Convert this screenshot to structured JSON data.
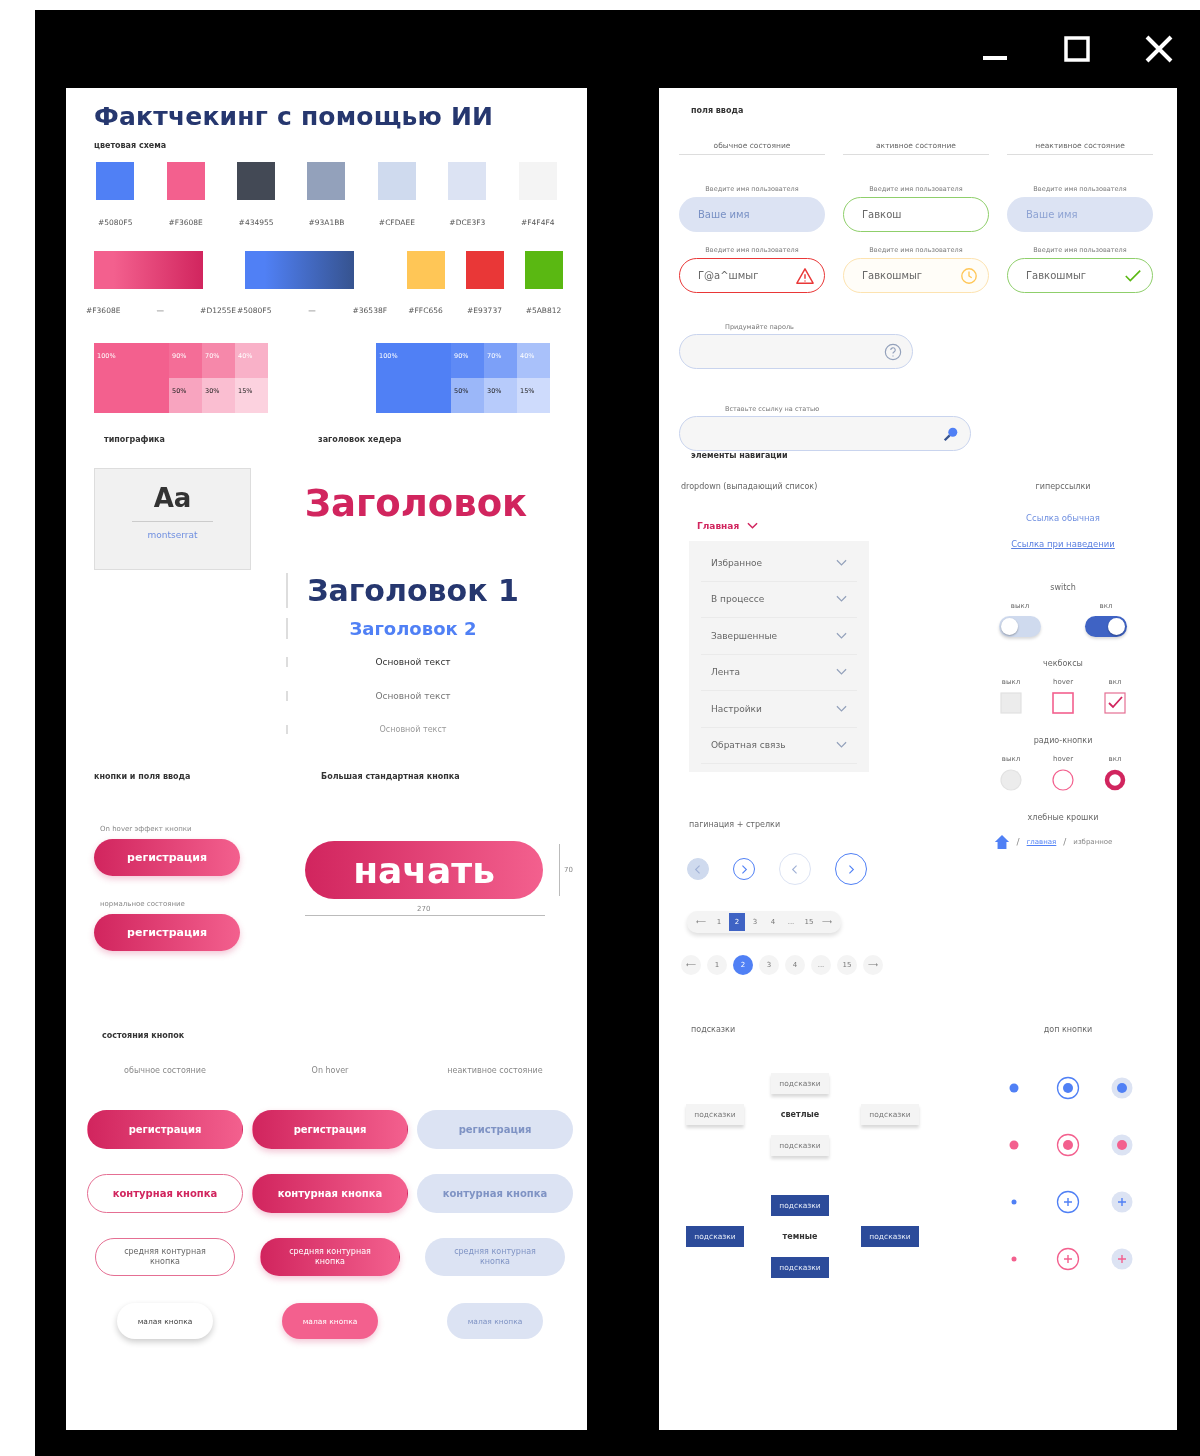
{
  "window_controls": [
    {
      "kind": "minimize"
    },
    {
      "kind": "maximize"
    },
    {
      "kind": "close"
    }
  ],
  "left": {
    "title": "Фактчекинг с помощью ИИ",
    "palette": {
      "heading": "цветовая схема",
      "swatches": [
        {
          "label": "#5080F5",
          "color": "#5080f5"
        },
        {
          "label": "#F3608E",
          "color": "#f3608e"
        },
        {
          "label": "#434955",
          "color": "#434955"
        },
        {
          "label": "#93A1BB",
          "color": "#93a1bb"
        },
        {
          "label": "#CFDAEE",
          "color": "#cfdaee"
        },
        {
          "label": "#DCE3F3",
          "color": "#dce3f3"
        },
        {
          "label": "#F4F4F4",
          "color": "#f4f4f4"
        }
      ],
      "gradients": [
        {
          "from_label": "#F3608E",
          "dash": "—",
          "to_label": "#D1255E",
          "color": "#f3608e"
        },
        {
          "from_label": "#5080F5",
          "dash": "—",
          "to_label": "#36538F",
          "color": "#5080f5"
        }
      ],
      "solids": [
        {
          "label": "#FFC656",
          "color": "#ffc656"
        },
        {
          "label": "#E93737",
          "color": "#e93737"
        },
        {
          "label": "#5AB812",
          "color": "#5ab812"
        }
      ],
      "tints": [
        {
          "color": "#f3608e",
          "cells": [
            {
              "label": "100%"
            },
            {
              "label": "90%"
            },
            {
              "label": "70%"
            },
            {
              "label": "40%"
            },
            {
              "label": "50%"
            },
            {
              "label": "30%"
            },
            {
              "label": "15%"
            }
          ]
        },
        {
          "color": "#5080f5",
          "cells": [
            {
              "label": "100%"
            },
            {
              "label": "90%"
            },
            {
              "label": "70%"
            },
            {
              "label": "40%"
            },
            {
              "label": "50%"
            },
            {
              "label": "30%"
            },
            {
              "label": "15%"
            }
          ]
        }
      ]
    },
    "typography": {
      "heading": "типографика",
      "sample": "Aa",
      "font_name": "montserrat"
    },
    "headers": {
      "heading": "заголовок хедера",
      "items": [
        {
          "label": "Заголовок",
          "kind": "display"
        },
        {
          "label": "Заголовок 1",
          "kind": "h1"
        },
        {
          "label": "Заголовок 2",
          "kind": "h2"
        },
        {
          "label": "Основной текст",
          "kind": "body"
        },
        {
          "label": "Основной текст",
          "kind": "muted"
        },
        {
          "label": "Основной текст",
          "kind": "faint"
        }
      ]
    },
    "buttons": {
      "heading": "кнопки и поля ввода",
      "examples": [
        {
          "caption": "On hover эффект кнопки",
          "label": "регистрация"
        },
        {
          "caption": "нормальное состояние",
          "label": "регистрация"
        }
      ],
      "big": {
        "heading": "Большая стандартная кнопка",
        "label": "начать",
        "width_label": "270",
        "height_label": "70"
      }
    },
    "states": {
      "heading": "состояния кнопок",
      "columns": [
        "обычное состояние",
        "On hover",
        "неактивное состояние"
      ],
      "rows": [
        {
          "kind": "filled",
          "cells": [
            {
              "label": "регистрация",
              "kind": "normal"
            },
            {
              "label": "регистрация",
              "kind": "hover"
            },
            {
              "label": "регистрация",
              "kind": "disabled"
            }
          ]
        },
        {
          "kind": "outline",
          "cells": [
            {
              "label": "контурная кнопка",
              "kind": "normal"
            },
            {
              "label": "контурная кнопка",
              "kind": "hover"
            },
            {
              "label": "контурная кнопка",
              "kind": "disabled"
            }
          ]
        },
        {
          "kind": "medium",
          "cells": [
            {
              "label": "средняя контурная кнопка",
              "kind": "normal"
            },
            {
              "label": "средняя контурная кнопка",
              "kind": "hover"
            },
            {
              "label": "средняя контурная кнопка",
              "kind": "disabled"
            }
          ]
        },
        {
          "kind": "small",
          "cells": [
            {
              "label": "малая кнопка",
              "kind": "normal"
            },
            {
              "label": "малая кнопка",
              "kind": "hover"
            },
            {
              "label": "малая кнопка",
              "kind": "disabled"
            }
          ]
        }
      ]
    }
  },
  "right": {
    "inputs": {
      "heading": "поля ввода",
      "columns": [
        "обычное состояние",
        "активное состояние",
        "неактивное состояние"
      ],
      "fields": [
        {
          "label": "Введите имя пользователя",
          "placeholder": "Ваше имя",
          "kind": "normal"
        },
        {
          "label": "Введите имя пользователя",
          "value": "Гавкош",
          "kind": "active"
        },
        {
          "label": "Введите имя пользователя",
          "placeholder": "Ваше имя",
          "kind": "disabled"
        },
        {
          "label": "Введите имя пользователя",
          "value": "Г@а^шмыг",
          "kind": "error"
        },
        {
          "label": "Введите имя пользователя",
          "value": "Гавкошмыг",
          "kind": "warning"
        },
        {
          "label": "Введите имя пользователя",
          "value": "Гавкошмыг",
          "kind": "success"
        }
      ],
      "extra": [
        {
          "label": "Придумайте пароль",
          "kind": "password"
        },
        {
          "label": "Вставьте ссылку на статью",
          "kind": "search"
        }
      ]
    },
    "navigation": {
      "heading": "элементы навигации",
      "dropdown": {
        "caption": "dropdown (выпадающий список)",
        "label": "Главная",
        "expanded": true,
        "items": [
          "Избранное",
          "В процессе",
          "Завершенные",
          "Лента",
          "Настройки",
          "Обратная связь"
        ]
      },
      "links": {
        "heading": "гиперссылки",
        "items": [
          {
            "label": "Ссылка обычная",
            "hovered": false
          },
          {
            "label": "Ссылка при наведении",
            "hovered": true
          }
        ]
      },
      "switches": {
        "heading": "switch",
        "items": [
          {
            "label": "выкл",
            "on": false
          },
          {
            "label": "вкл",
            "on": true
          }
        ]
      },
      "checkboxes": {
        "heading": "чекбоксы",
        "items": [
          {
            "label": "выкл",
            "checked": false,
            "hovered": false
          },
          {
            "label": "hover",
            "checked": false,
            "hovered": true
          },
          {
            "label": "вкл",
            "checked": true,
            "hovered": false
          }
        ]
      },
      "radios": {
        "heading": "радио-кнопки",
        "items": [
          {
            "label": "выкл",
            "checked": false,
            "hovered": false
          },
          {
            "label": "hover",
            "checked": false,
            "hovered": true
          },
          {
            "label": "вкл",
            "checked": true,
            "hovered": false
          }
        ]
      },
      "breadcrumbs": {
        "heading": "хлебные крошки",
        "items": [
          {
            "kind": "home"
          },
          {
            "kind": "separator",
            "label": "/"
          },
          {
            "kind": "link",
            "label": "главная"
          },
          {
            "kind": "separator",
            "label": "/"
          },
          {
            "kind": "current",
            "label": "избранное"
          }
        ]
      },
      "pagination": {
        "caption": "пагинация + стрелки",
        "arrows": [
          {
            "kind": "prev-small",
            "disabled": true
          },
          {
            "kind": "next-small",
            "disabled": false
          },
          {
            "kind": "prev-large",
            "disabled": true
          },
          {
            "kind": "next-large",
            "disabled": false
          }
        ],
        "pagers": [
          {
            "kind": "bar",
            "items": [
              {
                "label": "⟵",
                "selected": false
              },
              {
                "label": "1",
                "selected": false
              },
              {
                "label": "2",
                "selected": true
              },
              {
                "label": "3",
                "selected": false
              },
              {
                "label": "4",
                "selected": false
              },
              {
                "label": "...",
                "selected": false
              },
              {
                "label": "15",
                "selected": false
              },
              {
                "label": "⟶",
                "selected": false
              }
            ]
          },
          {
            "kind": "round",
            "items": [
              {
                "label": "⟵",
                "selected": false
              },
              {
                "label": "1",
                "selected": false
              },
              {
                "label": "2",
                "selected": true
              },
              {
                "label": "3",
                "selected": false
              },
              {
                "label": "4",
                "selected": false
              },
              {
                "label": "...",
                "selected": false
              },
              {
                "label": "15",
                "selected": false
              },
              {
                "label": "⟶",
                "selected": false
              }
            ]
          }
        ]
      }
    },
    "tooltips": {
      "heading": "подсказки",
      "groups": [
        {
          "kind": "light",
          "center": "светлые",
          "tips": [
            {
              "label": "подсказки",
              "kind": "top"
            },
            {
              "label": "подсказки",
              "kind": "left"
            },
            {
              "label": "подсказки",
              "kind": "right"
            },
            {
              "label": "подсказки",
              "kind": "bottom"
            }
          ]
        },
        {
          "kind": "dark",
          "center": "темные",
          "tips": [
            {
              "label": "подсказки",
              "kind": "top"
            },
            {
              "label": "подсказки",
              "kind": "left"
            },
            {
              "label": "подсказки",
              "kind": "right"
            },
            {
              "label": "подсказки",
              "kind": "bottom"
            }
          ]
        }
      ]
    },
    "extra_buttons": {
      "heading": "доп кнопки",
      "rows": [
        {
          "kind": "dot",
          "color": "#5080f5"
        },
        {
          "kind": "dot",
          "color": "#f3608e"
        },
        {
          "kind": "plus",
          "color": "#5080f5"
        },
        {
          "kind": "plus",
          "color": "#f3608e"
        }
      ]
    }
  }
}
